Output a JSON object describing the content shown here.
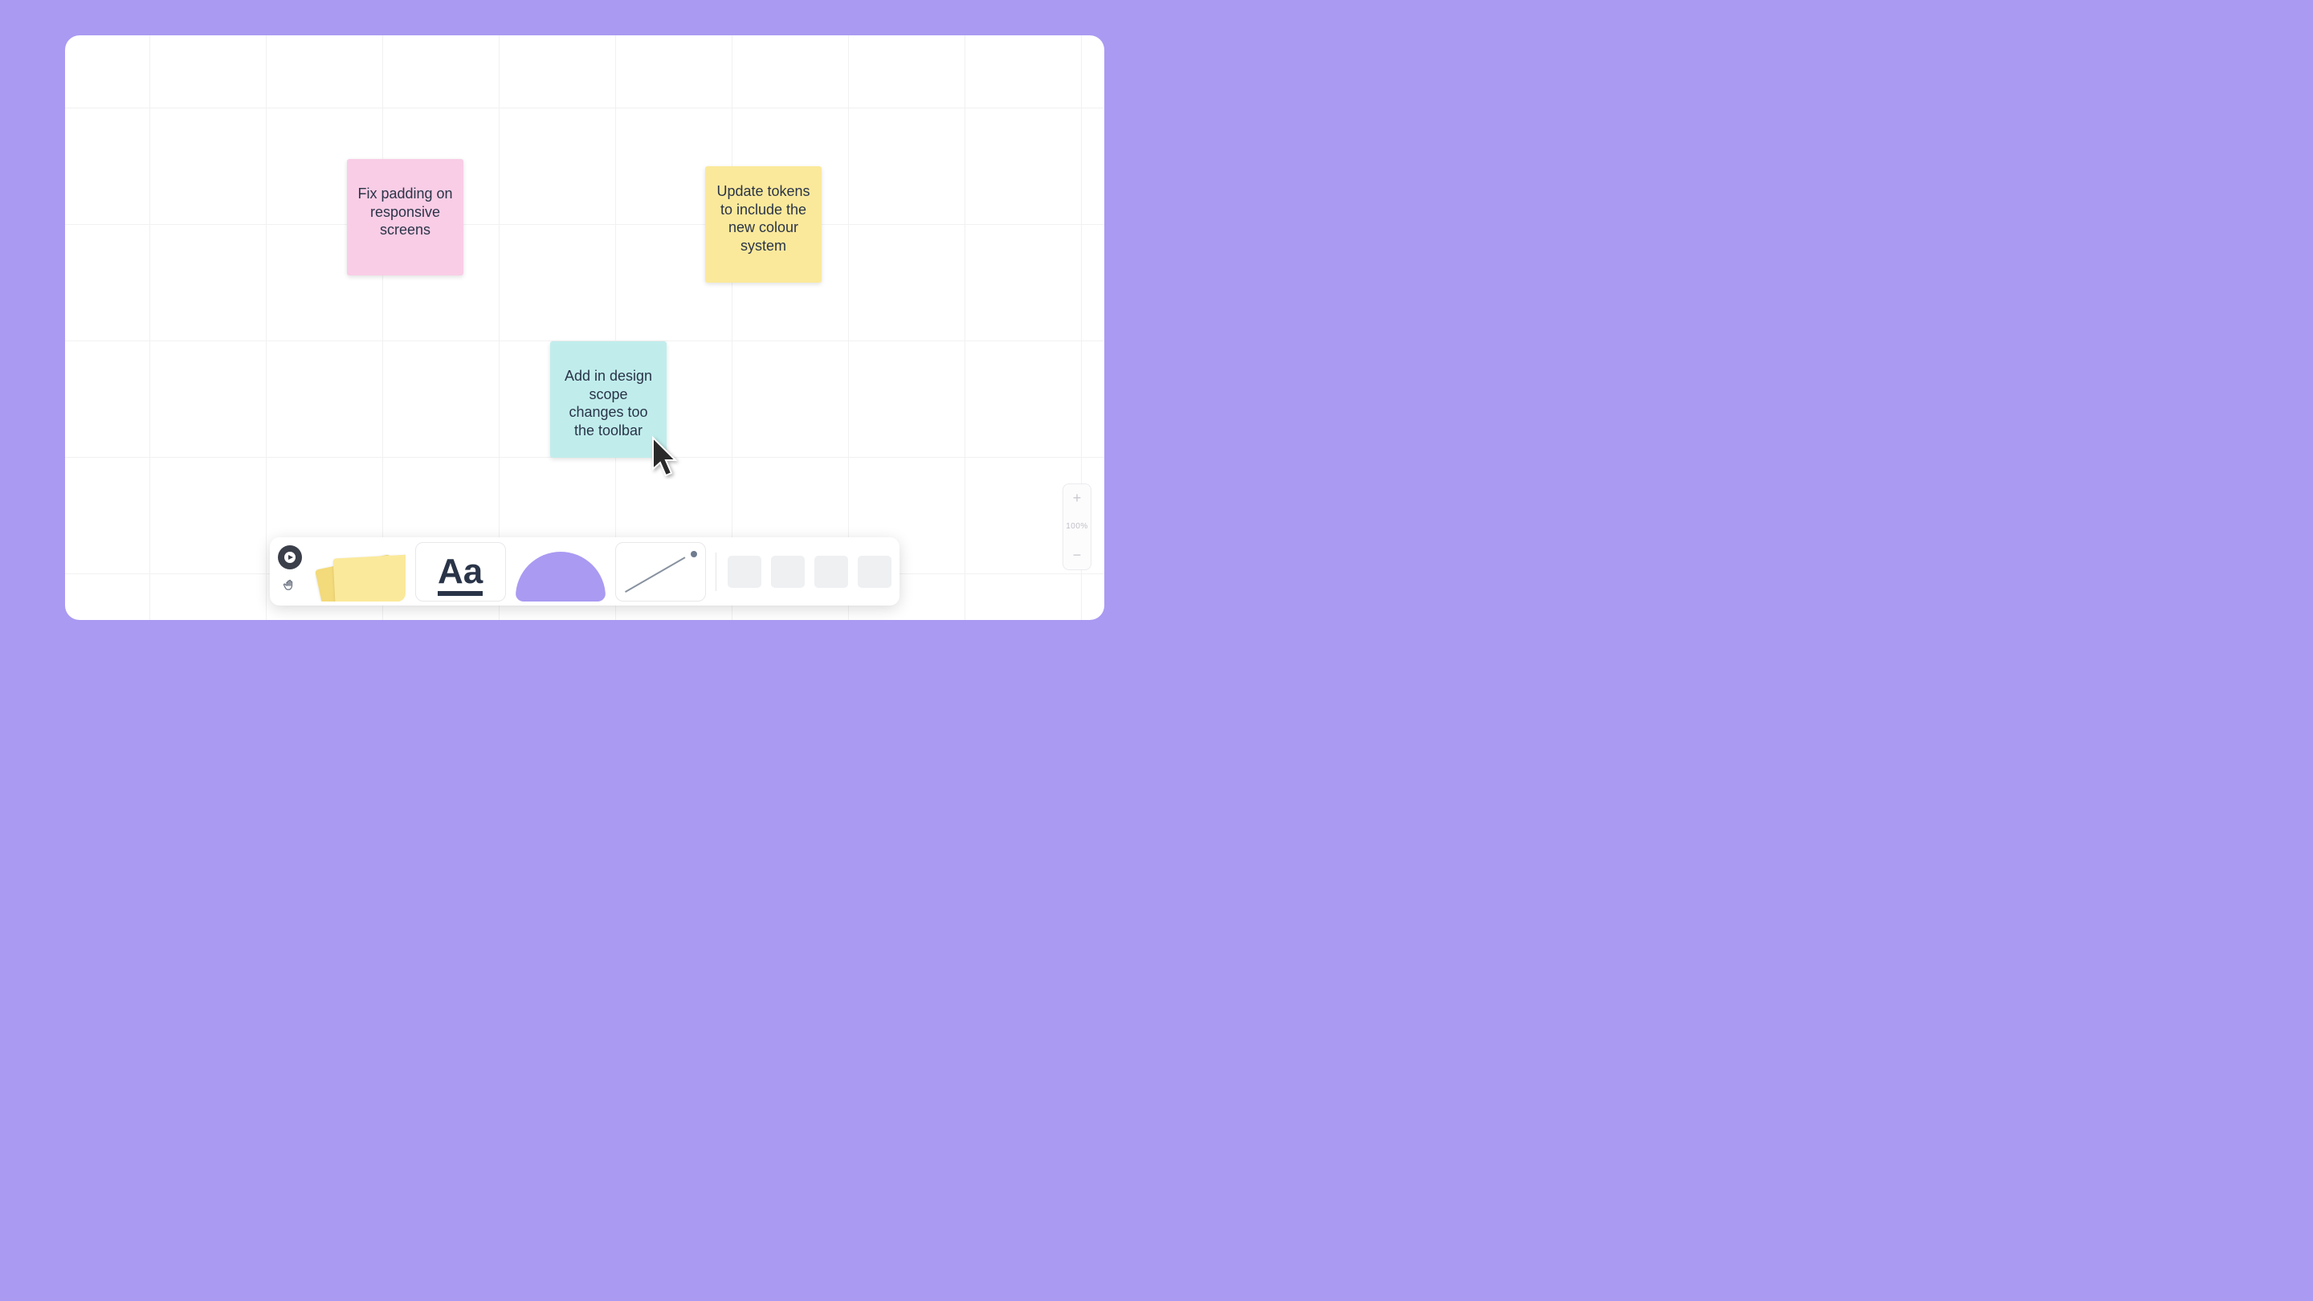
{
  "notes": {
    "pink": {
      "text": "Fix padding on responsive screens"
    },
    "yellow": {
      "text": "Update tokens to include the new colour system"
    },
    "cyan": {
      "text": "Add in design scope changes too the toolbar"
    }
  },
  "toolbar": {
    "text_tool_label": "Aa"
  },
  "zoom": {
    "plus": "+",
    "level": "100%",
    "minus": "−"
  },
  "colors": {
    "background": "#aa9af2",
    "sticky_pink": "#f9cde6",
    "sticky_yellow": "#fbe99b",
    "sticky_cyan": "#c0edec"
  }
}
